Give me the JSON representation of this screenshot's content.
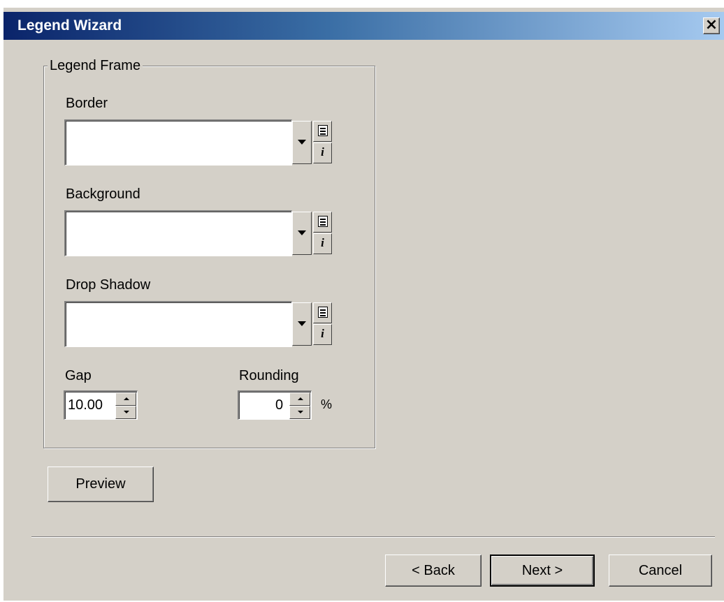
{
  "window": {
    "title": "Legend Wizard",
    "close_label": "×"
  },
  "legend_frame": {
    "group_label": "Legend Frame",
    "border_label": "Border",
    "border_value": "",
    "background_label": "Background",
    "background_value": "",
    "drop_shadow_label": "Drop Shadow",
    "drop_shadow_value": "",
    "gap_label": "Gap",
    "gap_value": "10.00",
    "rounding_label": "Rounding",
    "rounding_value": "0",
    "rounding_unit": "%"
  },
  "buttons": {
    "preview": "Preview",
    "back": "< Back",
    "next": "Next >",
    "cancel": "Cancel"
  },
  "icons": {
    "symbol_list": "list-icon",
    "properties": "info-icon",
    "dropdown": "chevron-down-icon"
  },
  "colors": {
    "dialog_face": "#d4d0c8",
    "title_gradient_start": "#0a246a",
    "title_gradient_end": "#a6caf0",
    "title_text": "#ffffff"
  }
}
